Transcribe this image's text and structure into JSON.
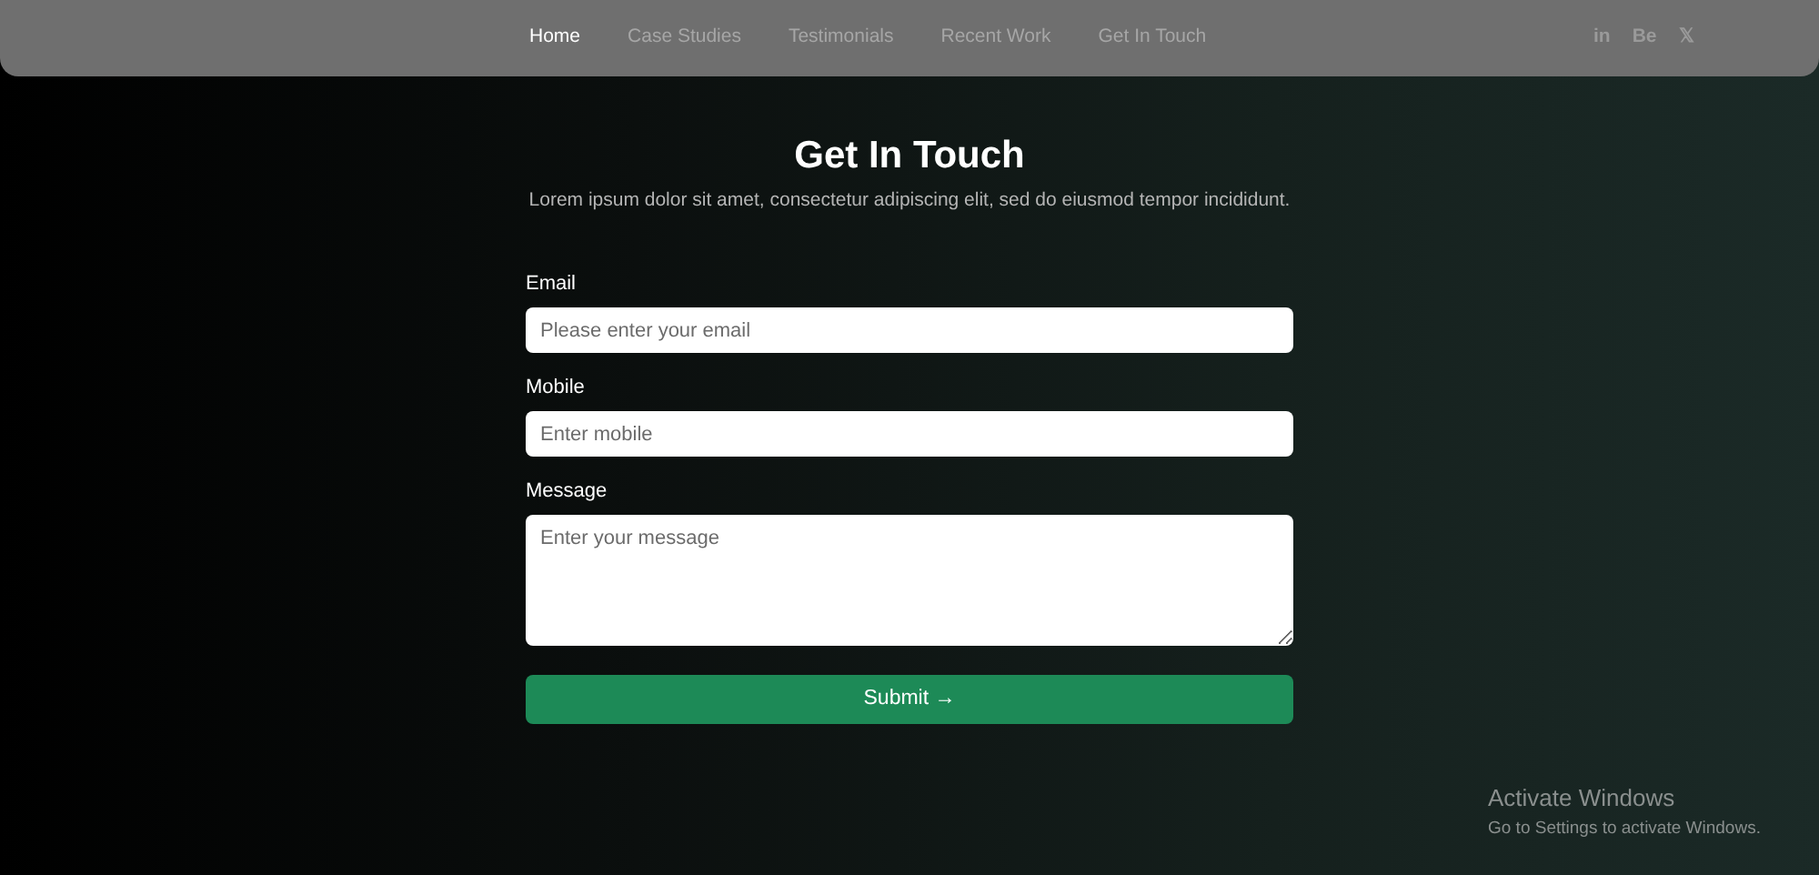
{
  "nav": {
    "links": [
      {
        "label": "Home",
        "selected": true
      },
      {
        "label": "Case Studies",
        "selected": false
      },
      {
        "label": "Testimonials",
        "selected": false
      },
      {
        "label": "Recent Work",
        "selected": false
      },
      {
        "label": "Get In Touch",
        "selected": false
      }
    ],
    "social": [
      "in",
      "Be",
      "𝕏"
    ]
  },
  "contact": {
    "title": "Get In Touch",
    "subtitle": "Lorem ipsum dolor sit amet, consectetur adipiscing elit, sed do eiusmod tempor incididunt.",
    "fields": [
      {
        "kind": "input",
        "label": "Email",
        "placeholder": "Please enter your email"
      },
      {
        "kind": "input",
        "label": "Mobile",
        "placeholder": "Enter mobile"
      },
      {
        "kind": "textarea",
        "label": "Message",
        "placeholder": "Enter your message"
      }
    ],
    "submit": "Submit →"
  },
  "os_notice": {
    "title": "Activate Windows",
    "text": "Go to Settings to activate Windows."
  }
}
